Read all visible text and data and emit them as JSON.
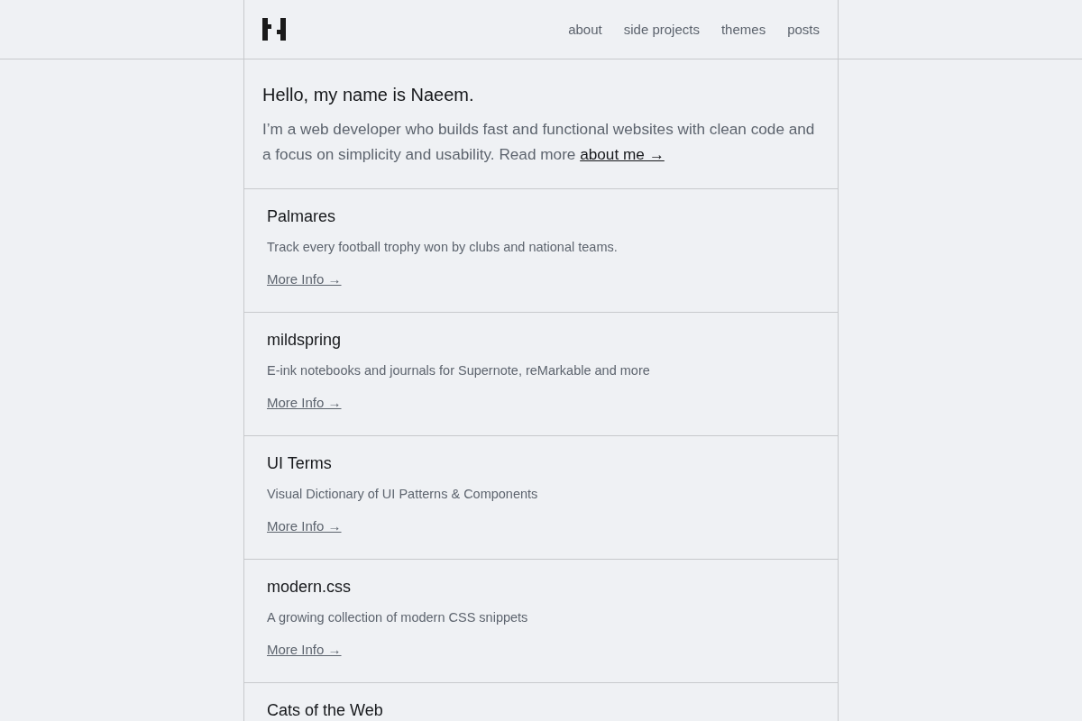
{
  "header": {
    "nav": [
      "about",
      "side projects",
      "themes",
      "posts"
    ]
  },
  "intro": {
    "heading": "Hello, my name is Naeem.",
    "text": "I’m a web developer who builds fast and functional websites with clean code and a focus on simplicity and usability. Read more",
    "link": "about me →"
  },
  "projects": [
    {
      "title": "Palmares",
      "description": "Track every football trophy won by clubs and national teams.",
      "link": "More Info →"
    },
    {
      "title": "mildspring",
      "description": "E-ink notebooks and journals for Supernote, reMarkable and more",
      "link": "More Info →"
    },
    {
      "title": "UI Terms",
      "description": "Visual Dictionary of UI Patterns & Components",
      "link": "More Info →"
    },
    {
      "title": "modern.css",
      "description": "A growing collection of modern CSS snippets",
      "link": "More Info →"
    },
    {
      "title": "Cats of the Web"
    }
  ]
}
